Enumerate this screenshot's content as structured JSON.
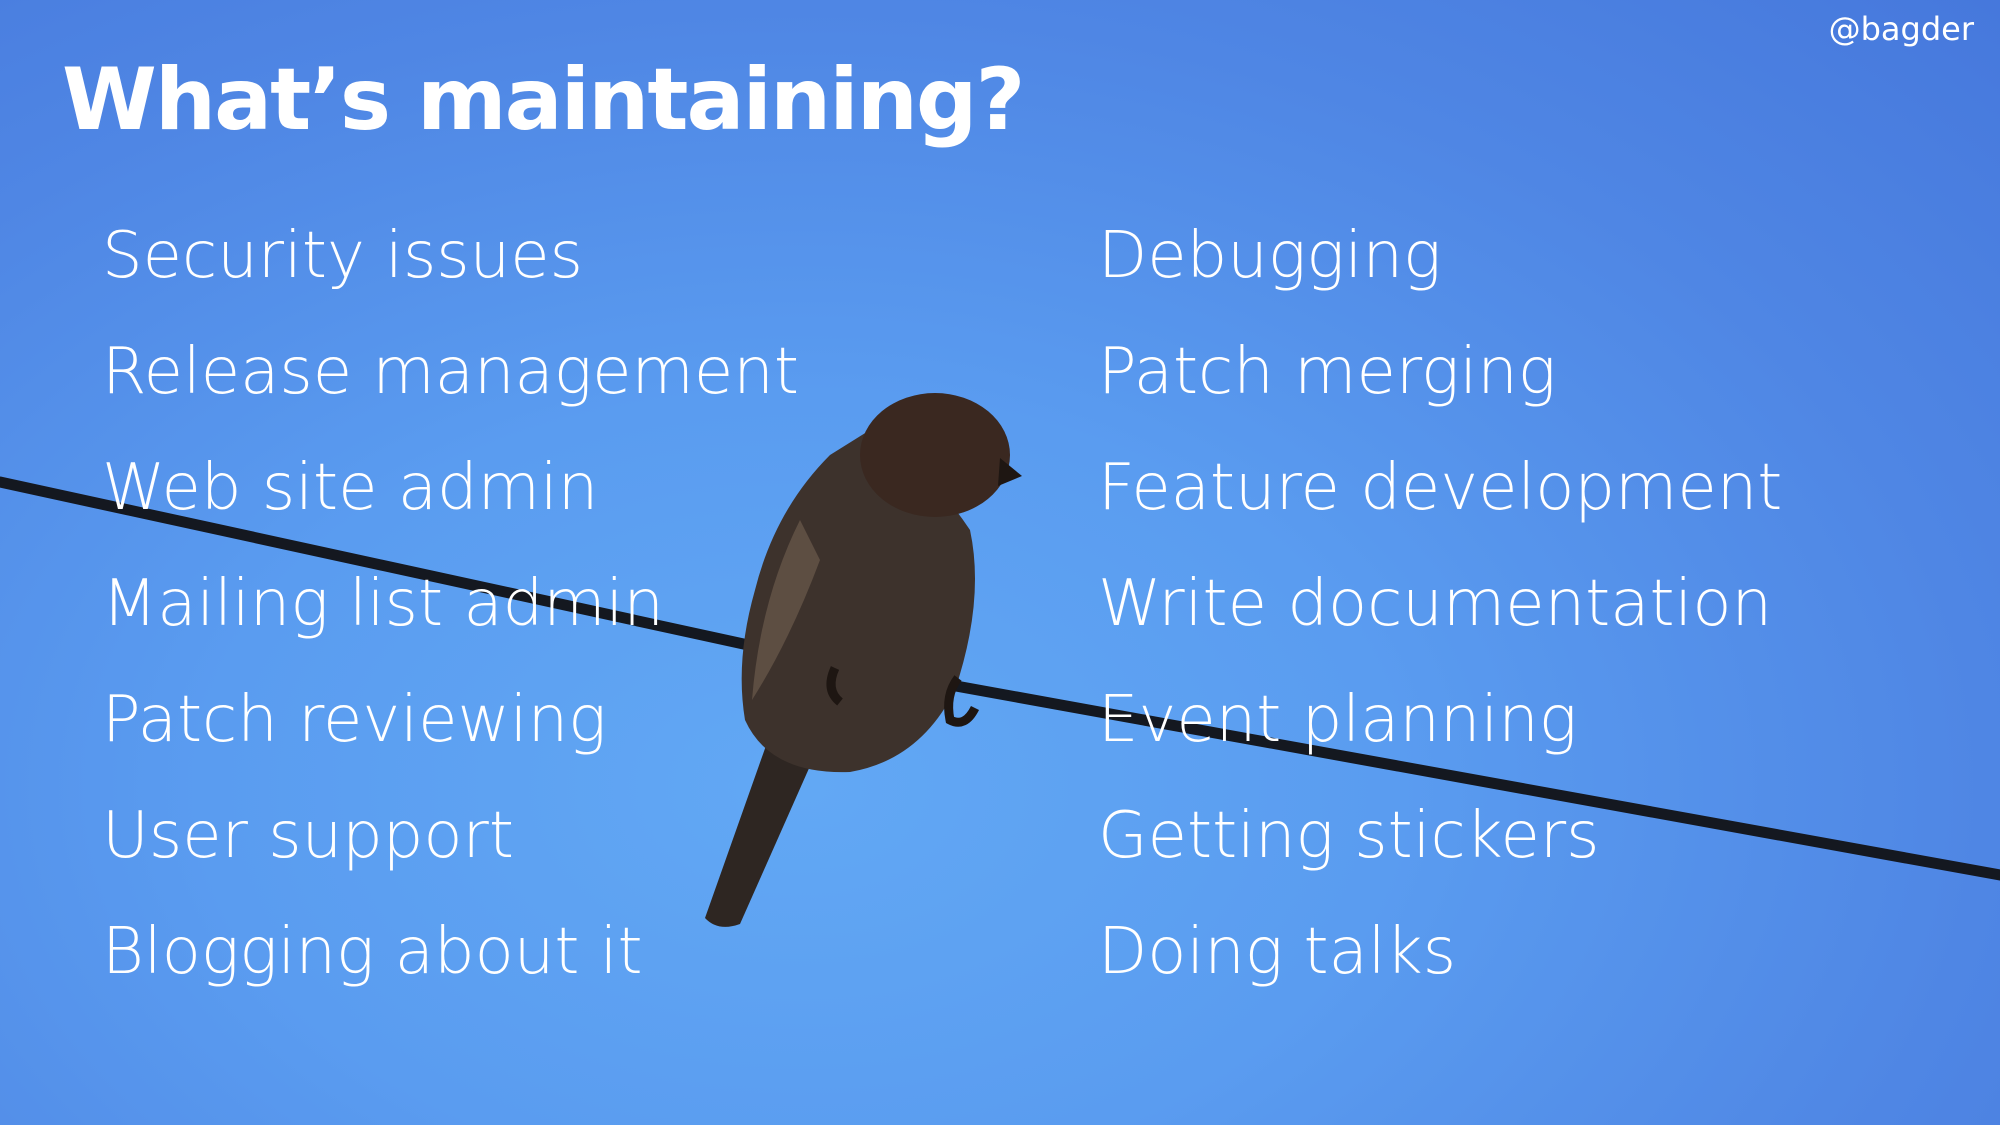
{
  "handle": "@bagder",
  "title": "What’s maintaining?",
  "left_items": [
    "Security issues",
    "Release management",
    "Web site admin",
    "Mailing list admin",
    "Patch reviewing",
    "User support",
    "Blogging about it"
  ],
  "right_items": [
    "Debugging",
    "Patch merging",
    "Feature development",
    "Write documentation",
    "Event planning",
    "Getting stickers",
    "Doing talks"
  ],
  "colors": {
    "sky": "#5a9cf0",
    "text": "#ffffff",
    "wire": "#141820",
    "bird": "#3a2e28"
  }
}
